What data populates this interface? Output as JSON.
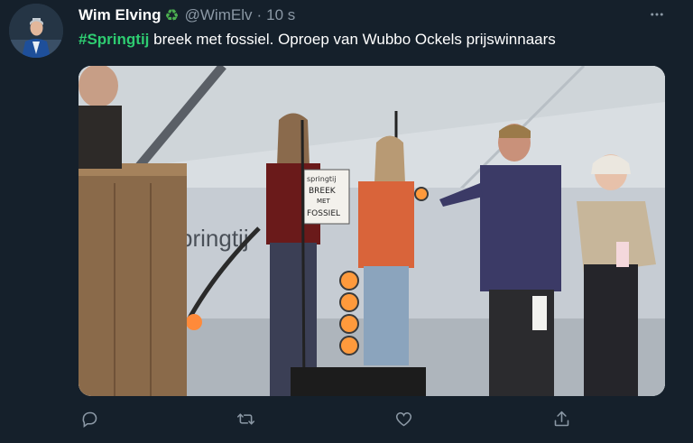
{
  "tweet": {
    "author": {
      "display_name": "Wim Elving",
      "badge_icon": "recycle-icon",
      "handle": "@WimElv",
      "separator": "·",
      "timestamp": "10 s"
    },
    "text": {
      "hashtag": "#Springtij",
      "body": " breek met fossiel. Oproep van Wubbo Ockels prijswinnaars"
    },
    "media": {
      "sign_lines": [
        "springtij",
        "BREEK",
        "MET",
        "FOSSIEL"
      ],
      "banner_text": "pringtij"
    },
    "actions": [
      "reply-icon",
      "retweet-icon",
      "like-icon",
      "share-icon"
    ],
    "colors": {
      "background": "#15202b",
      "hashtag": "#2ecc71",
      "muted": "#8b98a5"
    }
  }
}
